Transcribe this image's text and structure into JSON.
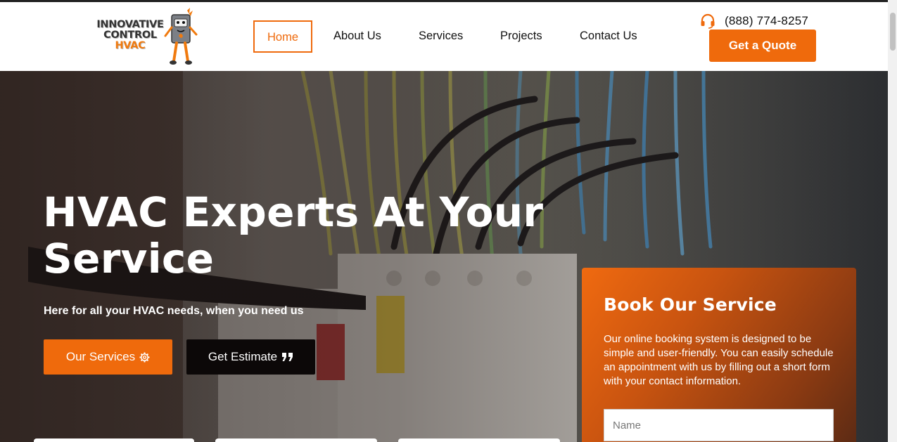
{
  "header": {
    "logo": {
      "line1": "INNOVATIVE",
      "line2": "CONTROL",
      "line3": "HVAC",
      "mascot_icon": "furnace-mascot-icon"
    },
    "nav": [
      {
        "label": "Home",
        "active": true
      },
      {
        "label": "About Us",
        "active": false
      },
      {
        "label": "Services",
        "active": false
      },
      {
        "label": "Projects",
        "active": false
      },
      {
        "label": "Contact Us",
        "active": false
      }
    ],
    "phone": {
      "icon": "headset-icon",
      "number": "(888) 774-8257"
    },
    "quote_label": "Get a Quote"
  },
  "hero": {
    "title": "HVAC Experts At Your Service",
    "subtitle": "Here for all your HVAC needs, when you need us",
    "services_label": "Our Services",
    "services_icon": "gear-icon",
    "estimate_label": "Get Estimate",
    "estimate_icon": "quote-marks-icon",
    "background_icon": "electrical-panel-wiring-photo"
  },
  "booking": {
    "title": "Book Our Service",
    "description": "Our online booking system is designed to be simple and user-friendly. You can easily schedule an appointment with us by filling out a short form with your contact information.",
    "name_placeholder": "Name"
  },
  "colors": {
    "accent": "#ef6a0c",
    "dark_button": "#0c0808",
    "text": "#111111"
  }
}
